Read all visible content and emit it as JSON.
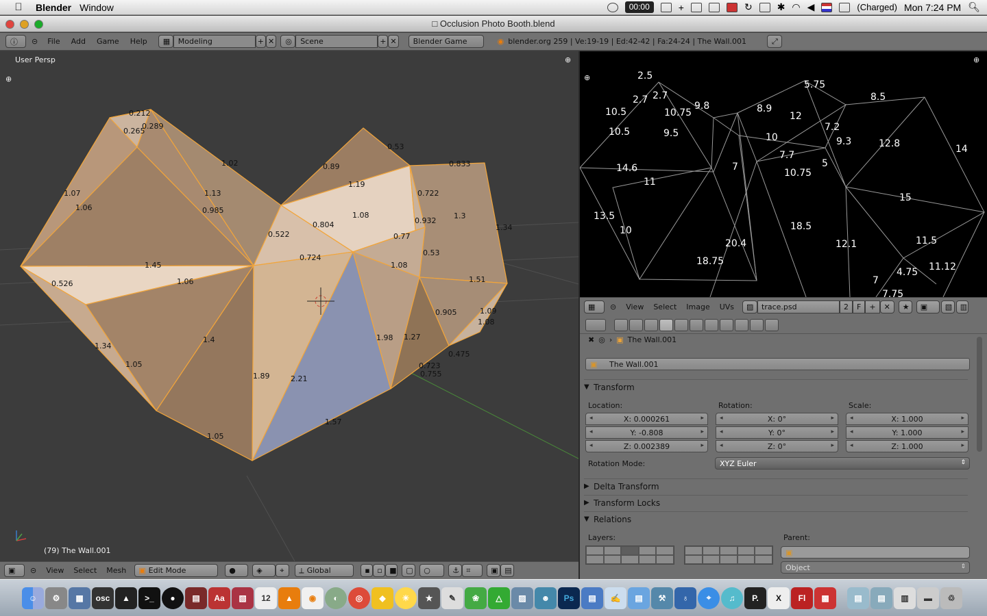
{
  "menubar": {
    "app_name": "Blender",
    "menus": [
      "Window"
    ],
    "timer": "00:00",
    "battery": "(Charged)",
    "clock": "Mon 7:24 PM"
  },
  "window": {
    "title": "Occlusion Photo Booth.blend"
  },
  "infobar": {
    "menus": [
      "File",
      "Add",
      "Game",
      "Help"
    ],
    "layout": "Modeling",
    "scene": "Scene",
    "engine": "Blender Game",
    "stats": "blender.org 259 | Ve:19-19 | Ed:42-42 | Fa:24-24 | The Wall.001"
  },
  "viewport": {
    "view_name": "User Persp",
    "object_label": "(79) The Wall.001",
    "edge_labels": [
      "0.212",
      "0.265",
      "0.289",
      "1.02",
      "0.89",
      "0.53",
      "0.833",
      "1.07",
      "1.06",
      "1.13",
      "0.985",
      "1.19",
      "0.722",
      "1.3",
      "1.34",
      "0.522",
      "0.804",
      "1.08",
      "0.932",
      "0.77",
      "0.724",
      "0.53",
      "1.45",
      "1.08",
      "1.06",
      "0.526",
      "1.51",
      "0.905",
      "1.09",
      "1.08",
      "1.34",
      "1.05",
      "1.4",
      "1.98",
      "1.27",
      "0.475",
      "0.723",
      "0.755",
      "1.89",
      "2.21",
      "1.57",
      "1.05"
    ]
  },
  "viewport_header": {
    "menus": [
      "View",
      "Select",
      "Mesh"
    ],
    "mode": "Edit Mode",
    "orientation": "Global"
  },
  "image_editor": {
    "numbers": [
      "2.5",
      "2.7",
      "2.7",
      "10.5",
      "10.75",
      "9.8",
      "8.9",
      "5.75",
      "8.5",
      "12",
      "10.5",
      "9.5",
      "7.2",
      "9.3",
      "10",
      "12.8",
      "7.7",
      "14",
      "14.6",
      "7",
      "5",
      "10.75",
      "11",
      "15",
      "13.5",
      "10",
      "18.5",
      "20.4",
      "12.1",
      "11.5",
      "18.75",
      "4.75",
      "11.12",
      "7",
      "7.75"
    ],
    "header_menus": [
      "View",
      "Select",
      "Image",
      "UVs"
    ],
    "image_name": "trace.psd",
    "users": "2",
    "fake_user": "F"
  },
  "properties": {
    "breadcrumb": "The Wall.001",
    "object_name": "The Wall.001",
    "transform_label": "Transform",
    "location_label": "Location:",
    "rotation_label": "Rotation:",
    "scale_label": "Scale:",
    "location": [
      "X: 0.000261",
      "Y: -0.808",
      "Z: 0.002389"
    ],
    "rotation": [
      "X: 0°",
      "Y: 0°",
      "Z: 0°"
    ],
    "scale": [
      "X: 1.000",
      "Y: 1.000",
      "Z: 1.000"
    ],
    "rotation_mode_label": "Rotation Mode:",
    "rotation_mode": "XYZ Euler",
    "delta_transform": "Delta Transform",
    "transform_locks": "Transform Locks",
    "relations": "Relations",
    "layers_label": "Layers:",
    "parent_label": "Parent:",
    "parent_type": "Object"
  }
}
